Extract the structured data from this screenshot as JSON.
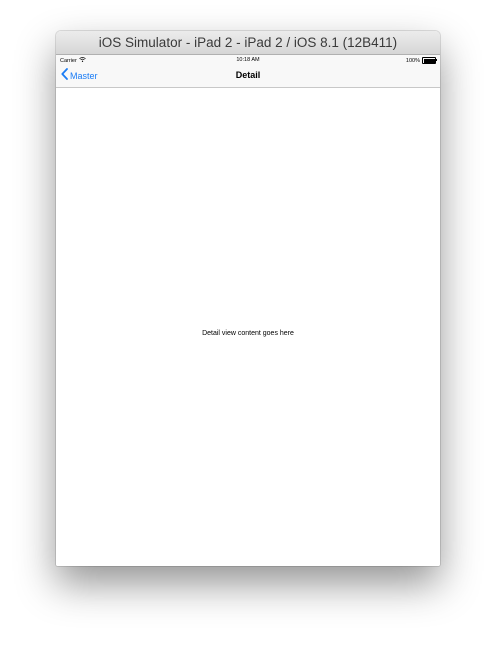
{
  "window": {
    "title": "iOS Simulator - iPad 2 - iPad 2 / iOS 8.1 (12B411)"
  },
  "status_bar": {
    "carrier": "Carrier",
    "time": "10:18 AM",
    "battery": "100%",
    "battery_level": 1.0,
    "wifi_icon": "wifi-icon",
    "battery_icon": "battery-icon"
  },
  "nav_bar": {
    "back_label": "Master",
    "back_icon": "chevron-left-icon",
    "title": "Detail",
    "accent_color": "#1a7cf5"
  },
  "content": {
    "text": "Detail view content goes here"
  }
}
